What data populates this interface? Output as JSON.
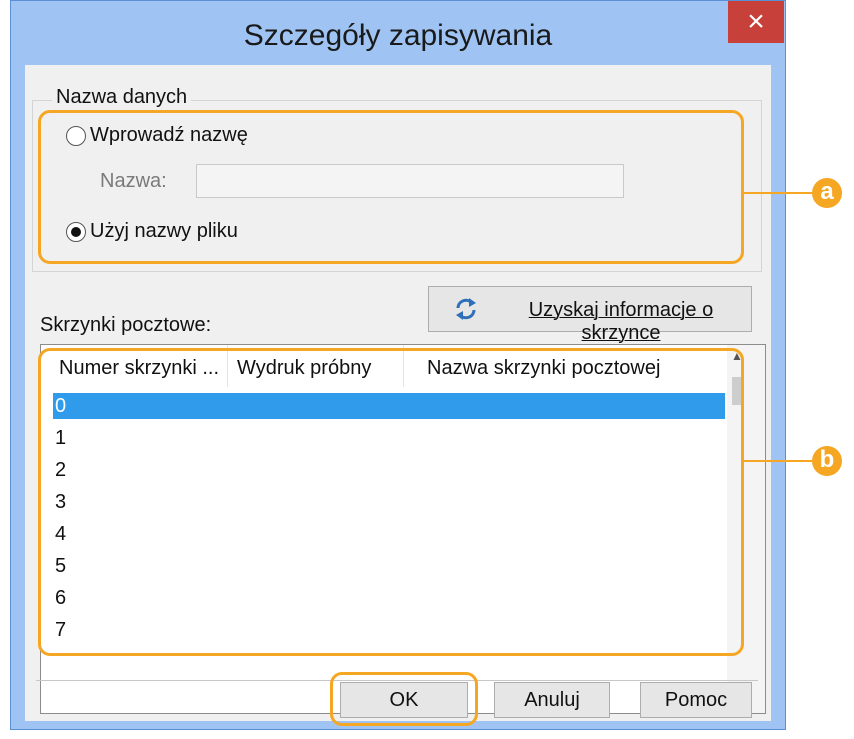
{
  "window": {
    "title": "Szczegóły zapisywania",
    "close_glyph": "×"
  },
  "data_name_group": {
    "label": "Nazwa danych",
    "enter_name_label": "Wprowadź nazwę",
    "enter_name_selected": false,
    "name_field_label": "Nazwa:",
    "name_field_value": "",
    "use_filename_label": "Użyj nazwy pliku",
    "use_filename_selected": true
  },
  "mailboxes": {
    "label": "Skrzynki pocztowe:",
    "get_info_button": "Uzyskaj informacje o skrzynce",
    "get_info_icon": "refresh-icon",
    "columns": [
      "Numer skrzynki ...",
      "Wydruk próbny",
      "Nazwa skrzynki pocztowej"
    ],
    "rows": [
      "0",
      "1",
      "2",
      "3",
      "4",
      "5",
      "6",
      "7"
    ],
    "selected_row": "0"
  },
  "buttons": {
    "ok": "OK",
    "cancel": "Anuluj",
    "help": "Pomoc"
  },
  "callouts": {
    "a": "a",
    "b": "b"
  },
  "colors": {
    "highlight": "#f5a623",
    "selection": "#2f9bea",
    "title_bar": "#9fc4f3",
    "close_button": "#c7403a"
  }
}
